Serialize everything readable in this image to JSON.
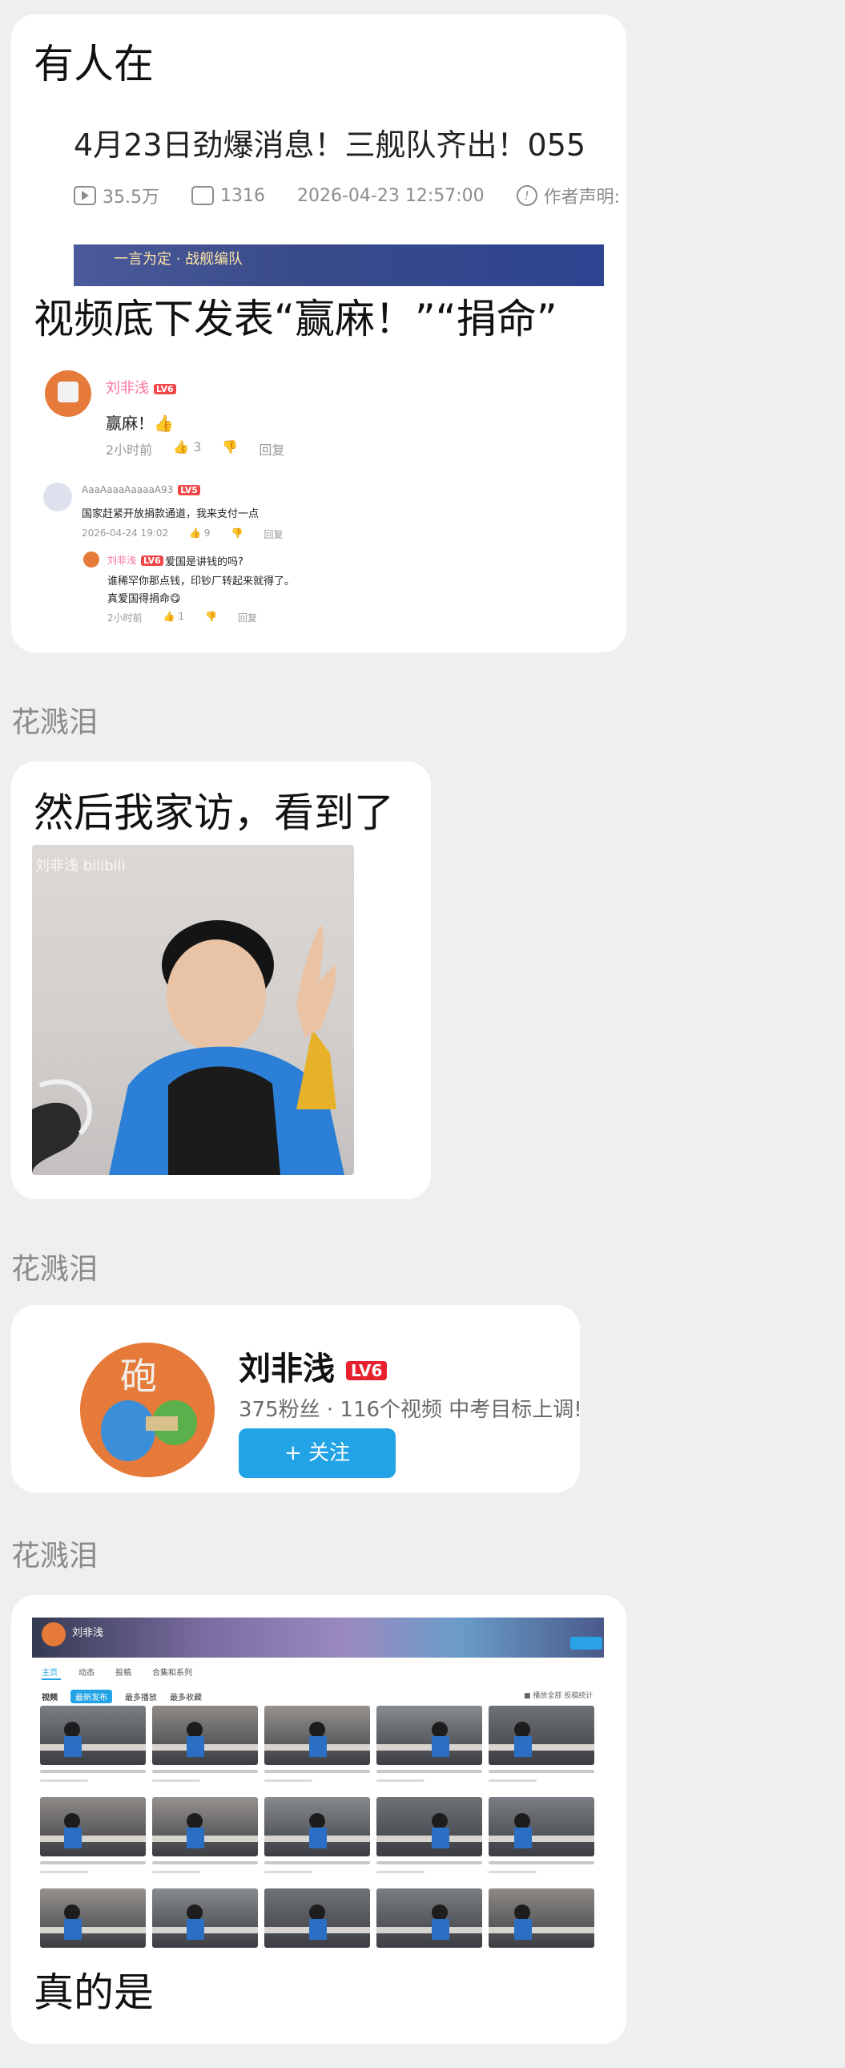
{
  "message1": {
    "line1": "有人在",
    "video_title": "4月23日劲爆消息！三舰队齐出！055",
    "video_views": "35.5万",
    "video_danmaku": "1316",
    "video_time": "2026-04-23 12:57:00",
    "video_declare": "作者声明:",
    "line2": "视频底下发表“赢麻！”“捐命”",
    "comments": [
      {
        "user": "刘非浅",
        "level": "LV6",
        "text": "赢麻！👍",
        "time": "2小时前",
        "likes": "3",
        "reply": "回复"
      },
      {
        "user": "AaaAaaaAaaaaA93",
        "level": "LV5",
        "text": "国家赶紧开放捐款通道，我来支付一点",
        "time": "2026-04-24 19:02",
        "likes": "9",
        "reply": "回复"
      },
      {
        "user": "刘非浅",
        "level": "LV6",
        "text_prefix": "爱国是讲钱的吗?",
        "text2": "谁稀罕你那点钱，印钞厂转起来就得了。",
        "text3": "真爱国得捐命😋",
        "time": "2小时前",
        "likes": "1",
        "reply": "回复"
      }
    ]
  },
  "sender2": "花溅泪",
  "message2": {
    "text": "然后我家访，看到了",
    "watermark_user": "刘非浅",
    "watermark_brand": "bilibili"
  },
  "sender3": "花溅泪",
  "message3": {
    "name": "刘非浅",
    "level": "LV6",
    "stats": "375粉丝 · 116个视频  中考目标上调!",
    "follow": "+ 关注"
  },
  "sender4": "花溅泪",
  "message4": {
    "space_name": "刘非浅",
    "tabs": [
      "主页",
      "动态",
      "投稿",
      "合集和系列"
    ],
    "section": "视频",
    "chips": [
      "最新发布",
      "最多播放",
      "最多收藏"
    ],
    "sort": "■ 播放全部   投稿统计",
    "text": "真的是"
  },
  "colors": {
    "bg": "#eeeff1",
    "accent": "#21a3e6",
    "pink": "#fb7299",
    "level": "#e8212e"
  }
}
